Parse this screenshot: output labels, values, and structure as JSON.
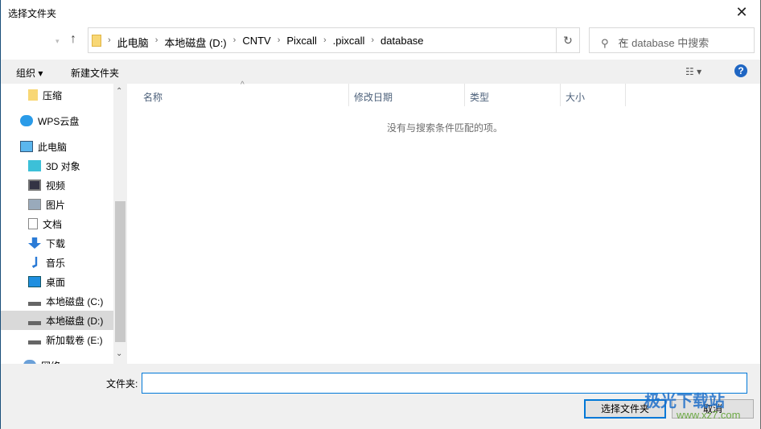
{
  "window": {
    "title": "选择文件夹",
    "close_icon": "close-icon"
  },
  "nav": {
    "path": [
      "此电脑",
      "本地磁盘 (D:)",
      "CNTV",
      "Pixcall",
      ".pixcall",
      "database"
    ],
    "search_placeholder": "在 database 中搜索"
  },
  "toolbar": {
    "organize": "组织",
    "new_folder": "新建文件夹",
    "help": "?"
  },
  "sidebar": {
    "items": [
      {
        "label": "压缩",
        "icon": "folder-icon"
      },
      {
        "label": "WPS云盘",
        "icon": "cloud-icon"
      },
      {
        "label": "此电脑",
        "icon": "computer-icon"
      },
      {
        "label": "3D 对象",
        "icon": "cube-icon"
      },
      {
        "label": "视频",
        "icon": "video-icon"
      },
      {
        "label": "图片",
        "icon": "picture-icon"
      },
      {
        "label": "文档",
        "icon": "document-icon"
      },
      {
        "label": "下载",
        "icon": "download-icon"
      },
      {
        "label": "音乐",
        "icon": "music-icon"
      },
      {
        "label": "桌面",
        "icon": "desktop-icon"
      },
      {
        "label": "本地磁盘 (C:)",
        "icon": "drive-icon"
      },
      {
        "label": "本地磁盘 (D:)",
        "icon": "drive-icon",
        "selected": true
      },
      {
        "label": "新加载卷 (E:)",
        "icon": "drive-icon"
      },
      {
        "label": "网络",
        "icon": "network-icon"
      }
    ]
  },
  "columns": [
    "名称",
    "修改日期",
    "类型",
    "大小"
  ],
  "empty_message": "没有与搜索条件匹配的项。",
  "footer": {
    "folder_label": "文件夹:",
    "folder_value": "",
    "select_button": "选择文件夹",
    "cancel_button": "取消"
  },
  "watermark": {
    "text": "极光下载站",
    "url": "www.xz7.com"
  },
  "colors": {
    "accent": "#0078d7",
    "selected": "#d9d9d9"
  }
}
